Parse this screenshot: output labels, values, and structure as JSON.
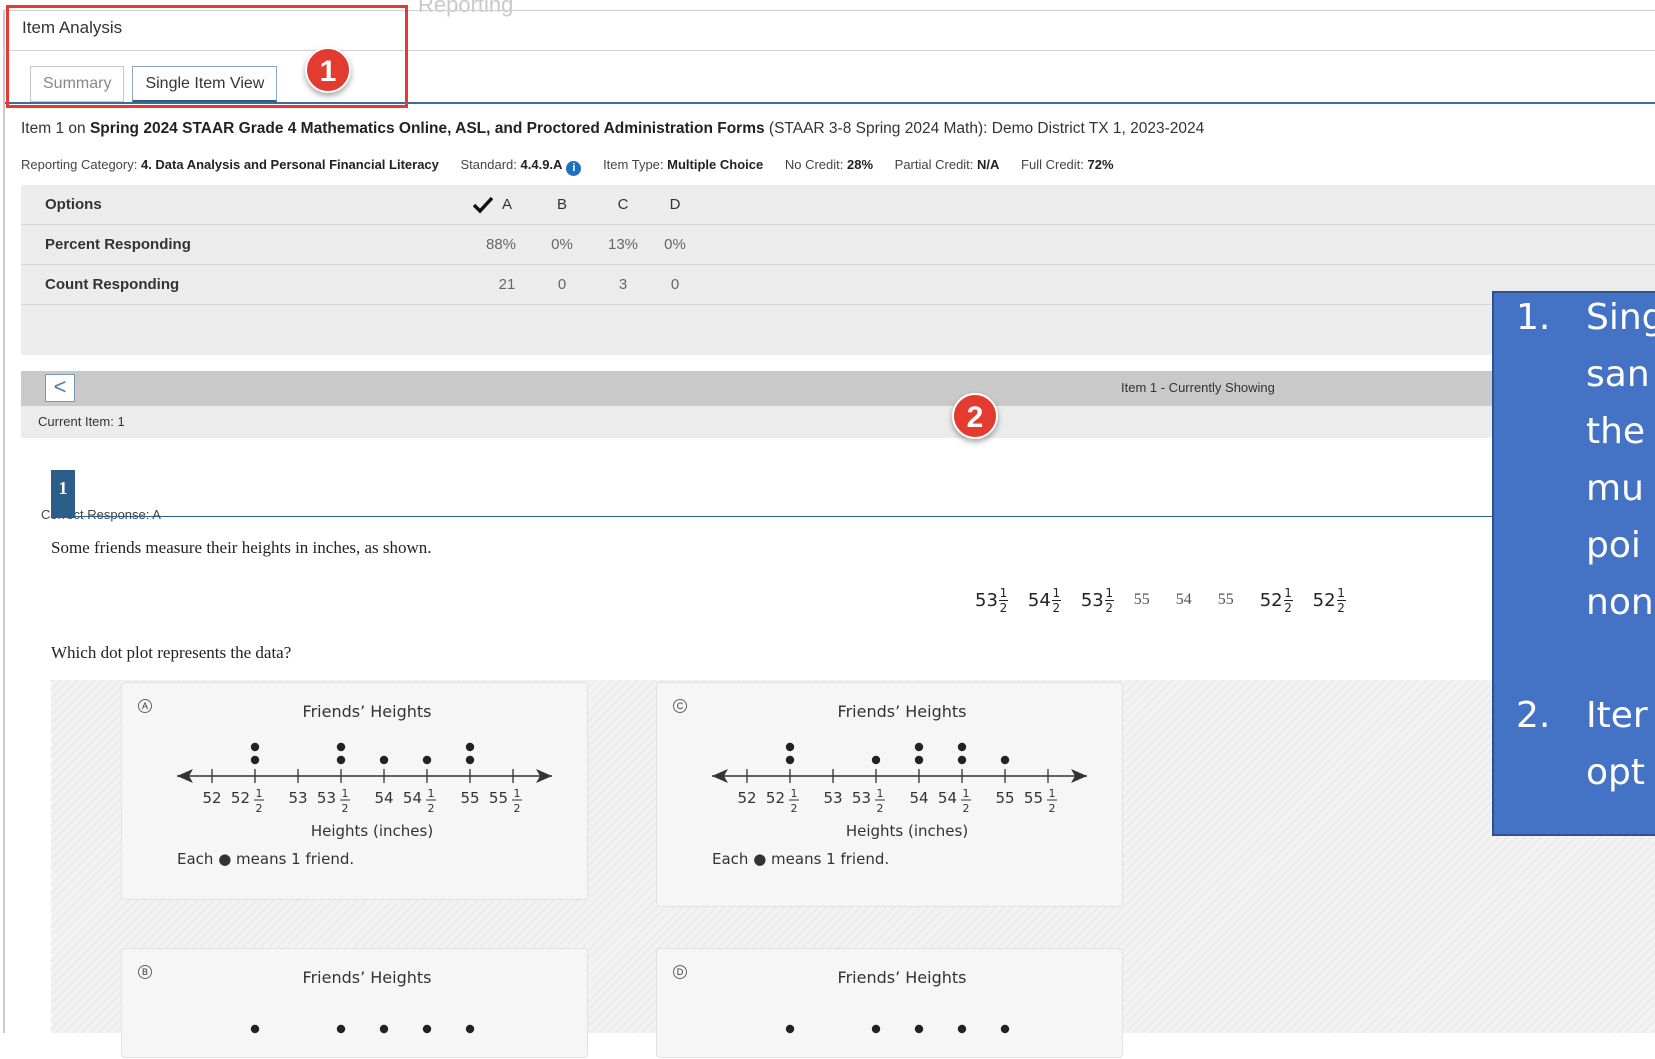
{
  "ghost_title": "Reporting",
  "panel": {
    "title": "Item Analysis"
  },
  "tabs": [
    {
      "label": "Summary",
      "active": false
    },
    {
      "label": "Single Item View",
      "active": true
    }
  ],
  "badges": {
    "one": "1",
    "two": "2"
  },
  "item_line": {
    "prefix": "Item 1 on ",
    "assessment": "Spring 2024 STAAR Grade 4 Mathematics Online, ASL, and Proctored Administration Forms",
    "suffix": " (STAAR 3-8 Spring 2024 Math): Demo District TX 1, 2023-2024"
  },
  "meta": {
    "reporting_category_label": "Reporting Category:",
    "reporting_category_value": "4. Data Analysis and Personal Financial Literacy",
    "standard_label": "Standard:",
    "standard_value": "4.4.9.A",
    "info_icon": "i",
    "item_type_label": "Item Type:",
    "item_type_value": "Multiple Choice",
    "no_credit_label": "No Credit:",
    "no_credit_value": "28%",
    "partial_credit_label": "Partial Credit:",
    "partial_credit_value": "N/A",
    "full_credit_label": "Full Credit:",
    "full_credit_value": "72%"
  },
  "options_table": {
    "header_label": "Options",
    "options": [
      "A",
      "B",
      "C",
      "D"
    ],
    "correct_option_index": 0,
    "rows": [
      {
        "label": "Percent Responding",
        "values": [
          "88%",
          "0%",
          "13%",
          "0%"
        ]
      },
      {
        "label": "Count Responding",
        "values": [
          "21",
          "0",
          "3",
          "0"
        ]
      }
    ],
    "correct_response": "Correct Response: A"
  },
  "navigator": {
    "prev_icon": "<",
    "showing_text": "Item 1 - Currently Showing",
    "current_item": "Current Item: 1"
  },
  "question": {
    "number": "1",
    "prompt": "Some friends measure their heights in inches, as shown.",
    "data_values": [
      {
        "whole": "53",
        "num": "1",
        "den": "2"
      },
      {
        "whole": "54",
        "num": "1",
        "den": "2"
      },
      {
        "whole": "53",
        "num": "1",
        "den": "2"
      },
      {
        "whole": "55"
      },
      {
        "whole": "54"
      },
      {
        "whole": "55"
      },
      {
        "whole": "52",
        "num": "1",
        "den": "2"
      },
      {
        "whole": "52",
        "num": "1",
        "den": "2"
      }
    ],
    "prompt2": "Which dot plot represents the data?"
  },
  "choices": [
    {
      "letter": "A",
      "title": "Friends’ Heights",
      "xlabel": "Heights (inches)",
      "key": "Each ● means 1 friend.",
      "dots": [
        0,
        2,
        0,
        2,
        1,
        1,
        2,
        0
      ]
    },
    {
      "letter": "C",
      "title": "Friends’ Heights",
      "xlabel": "Heights (inches)",
      "key": "Each ● means 1 friend.",
      "dots": [
        0,
        2,
        0,
        1,
        2,
        2,
        1,
        0
      ]
    },
    {
      "letter": "B",
      "title": "Friends’ Heights",
      "visible_dots": [
        0,
        1,
        0,
        1,
        1,
        1,
        1,
        0
      ]
    },
    {
      "letter": "D",
      "title": "Friends’ Heights",
      "visible_dots": [
        0,
        1,
        0,
        1,
        1,
        1,
        1,
        0
      ]
    }
  ],
  "tick_labels": [
    {
      "whole": "52"
    },
    {
      "whole": "52",
      "frac": "1/2"
    },
    {
      "whole": "53"
    },
    {
      "whole": "53",
      "frac": "1/2"
    },
    {
      "whole": "54"
    },
    {
      "whole": "54",
      "frac": "1/2"
    },
    {
      "whole": "55"
    },
    {
      "whole": "55",
      "frac": "1/2"
    }
  ],
  "callout": {
    "items": [
      {
        "num": "1.",
        "lines": [
          "Sing",
          "san",
          "the",
          "mu",
          "poi",
          "non"
        ]
      },
      {
        "num": "2.",
        "lines": [
          "Iter",
          "opt"
        ]
      }
    ]
  },
  "colors": {
    "accent": "#2c5e8a",
    "badge": "#e33b2f",
    "callout": "#4472c4",
    "highlight_border": "#e53935"
  }
}
